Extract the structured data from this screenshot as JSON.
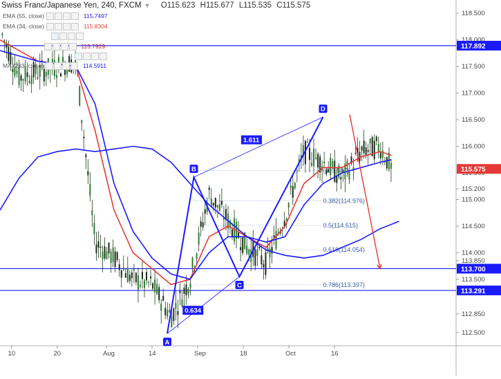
{
  "header": {
    "symbol": "Swiss Franc/Japanese Yen, 240, FXCM",
    "open": "O115.623",
    "high": "H115.677",
    "low": "L115.535",
    "close": "C115.575"
  },
  "indicators": [
    {
      "name": "EMA (55, close)",
      "value": "115.7497",
      "color": "#1a1aff"
    },
    {
      "name": "EMA (34, close)",
      "value": "115.8304",
      "color": "#e53935"
    },
    {
      "name": "",
      "value": "",
      "color": "#1a1aff"
    },
    {
      "name": "",
      "value": "115.7929",
      "color": "#c62828"
    },
    {
      "name": "",
      "value": "",
      "color": "#1a1aff"
    },
    {
      "name": "MA (233, close)",
      "value": "114.5911",
      "color": "#1a1aff"
    }
  ],
  "chart_data": {
    "type": "line",
    "title": "Swiss Franc/Japanese Yen, 240, FXCM",
    "xlabel": "",
    "ylabel": "",
    "ylim": [
      112.25,
      118.75
    ],
    "x_ticks": [
      "10",
      "20",
      "Aug",
      "14",
      "Sep",
      "18",
      "Oct",
      "16"
    ],
    "y_ticks": [
      "112.500",
      "112.850",
      "113.500",
      "113.850",
      "114.000",
      "114.500",
      "115.000",
      "115.200",
      "115.500",
      "116.000",
      "116.500",
      "117.000",
      "117.500",
      "118.000",
      "118.500"
    ],
    "series": [
      {
        "name": "",
        "x": [
          0,
          5,
          10,
          15,
          20,
          25,
          30,
          35,
          40,
          45,
          50,
          55,
          60,
          65,
          70,
          75,
          80,
          85,
          90,
          95,
          100,
          103
        ],
        "values": [
          118.2,
          117.3,
          117.4,
          117.5,
          117.6,
          114.2,
          113.9,
          113.5,
          113.4,
          112.8,
          113.5,
          115.1,
          114.6,
          114.1,
          113.8,
          114.7,
          115.9,
          115.7,
          115.4,
          115.9,
          116.0,
          115.575
        ],
        "color": "#1b5e20"
      },
      {
        "name": "EMA (34, close)",
        "x": [
          0,
          10,
          20,
          25,
          30,
          35,
          40,
          45,
          50,
          55,
          60,
          65,
          70,
          75,
          80,
          85,
          90,
          95,
          100,
          103
        ],
        "values": [
          118.0,
          117.6,
          117.5,
          116.3,
          114.8,
          114.0,
          113.7,
          113.4,
          113.5,
          114.3,
          114.5,
          114.3,
          114.1,
          114.5,
          115.3,
          115.6,
          115.6,
          115.8,
          115.9,
          115.83
        ],
        "color": "#e53935"
      },
      {
        "name": "EMA (55, close)",
        "x": [
          0,
          10,
          20,
          25,
          30,
          35,
          40,
          45,
          50,
          55,
          60,
          65,
          70,
          75,
          80,
          85,
          90,
          95,
          100,
          103
        ],
        "values": [
          117.8,
          117.6,
          117.5,
          116.8,
          115.3,
          114.4,
          113.9,
          113.6,
          113.5,
          114.0,
          114.3,
          114.3,
          114.2,
          114.3,
          114.9,
          115.3,
          115.5,
          115.6,
          115.7,
          115.75
        ],
        "color": "#1a1aff"
      },
      {
        "name": "MA (233, close)",
        "x": [
          0,
          5,
          10,
          15,
          20,
          25,
          30,
          35,
          40,
          45,
          50,
          55,
          60,
          65,
          70,
          75,
          80,
          85,
          90,
          95,
          100,
          105
        ],
        "values": [
          114.8,
          115.4,
          115.8,
          115.9,
          115.95,
          115.9,
          115.95,
          116.0,
          115.95,
          115.7,
          115.3,
          114.9,
          114.6,
          114.3,
          114.05,
          113.95,
          113.9,
          113.95,
          114.1,
          114.25,
          114.45,
          114.59
        ],
        "color": "#1a1aff"
      }
    ],
    "x_range": [
      0,
      120
    ],
    "harmonic_pattern": {
      "points": [
        {
          "label": "A",
          "x": 44,
          "y": 112.48
        },
        {
          "label": "B",
          "x": 51,
          "y": 115.42
        },
        {
          "label": "C",
          "x": 63,
          "y": 113.55
        },
        {
          "label": "D",
          "x": 85,
          "y": 116.55
        }
      ],
      "ab_extension_label": "0.634",
      "cd_label": "1.611"
    },
    "horizontal_levels": [
      {
        "value": 117.892,
        "label": "117.892",
        "color": "#1a1aff"
      },
      {
        "value": 113.7,
        "label": "113.700",
        "color": "#1a1aff"
      },
      {
        "value": 113.291,
        "label": "113.291",
        "color": "#1a1aff"
      }
    ],
    "fib_levels": [
      {
        "value": 115.547,
        "label": "(115.547)",
        "ratio": ""
      },
      {
        "value": 114.976,
        "label": "0.382(114.976)",
        "ratio": "0.382"
      },
      {
        "value": 114.515,
        "label": "0.5(114.515)",
        "ratio": "0.5"
      },
      {
        "value": 114.054,
        "label": "0.618(114.054)",
        "ratio": "0.618"
      },
      {
        "value": 113.397,
        "label": "0.786(113.397)",
        "ratio": "0.786"
      }
    ],
    "current_price": {
      "value": 115.575,
      "label": "115.575",
      "color": "#e53935"
    },
    "forecast_arrow": {
      "from_x": 92,
      "from_y": 116.6,
      "to_x": 100,
      "to_y": 113.7,
      "color": "#e53935"
    }
  }
}
